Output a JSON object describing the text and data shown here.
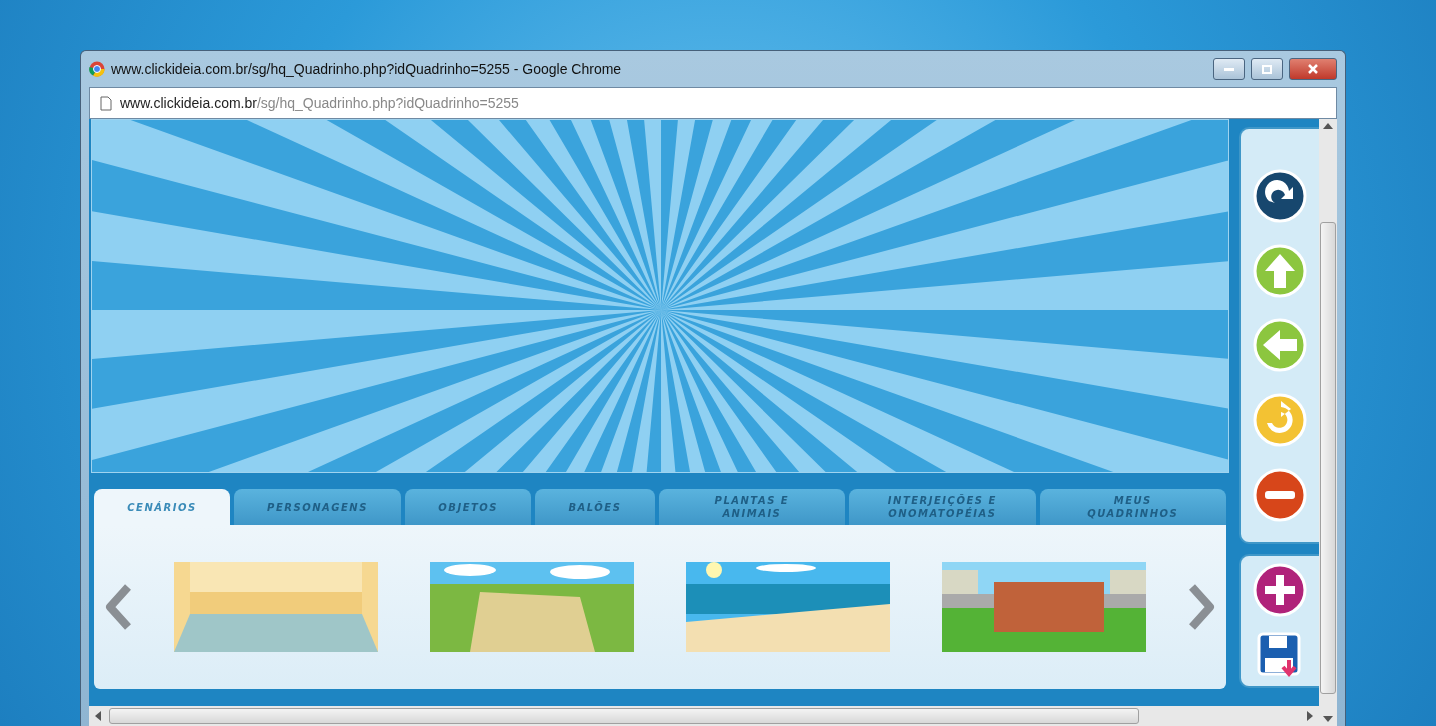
{
  "window": {
    "title": "www.clickideia.com.br/sg/hq_Quadrinho.php?idQuadrinho=5255 - Google Chrome"
  },
  "address_bar": {
    "host": "www.clickideia.com.br",
    "path": "/sg/hq_Quadrinho.php?idQuadrinho=5255"
  },
  "tabs": [
    {
      "label": "CENÁRIOS",
      "selected": true
    },
    {
      "label": "PERSONAGENS",
      "selected": false
    },
    {
      "label": "OBJETOS",
      "selected": false
    },
    {
      "label": "BALÕES",
      "selected": false
    },
    {
      "label": "PLANTAS E ANIMAIS",
      "selected": false
    },
    {
      "label": "INTERJEIÇÕES E ONOMATOPÉIAS",
      "selected": false
    },
    {
      "label": "MEUS QUADRINHOS",
      "selected": false
    }
  ],
  "scenes": [
    {
      "kind": "room"
    },
    {
      "kind": "field"
    },
    {
      "kind": "beach"
    },
    {
      "kind": "wall"
    }
  ]
}
